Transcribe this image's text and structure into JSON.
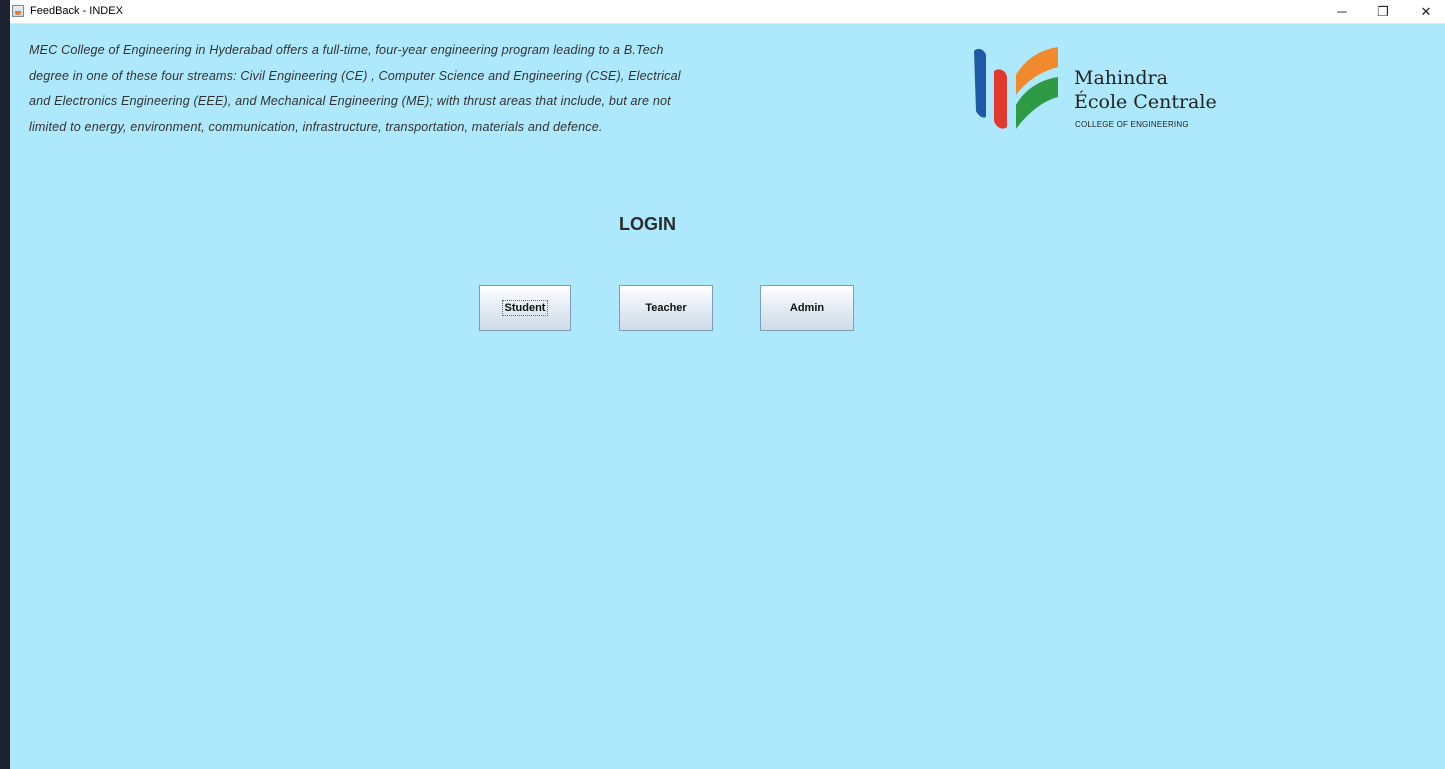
{
  "window": {
    "title": "FeedBack - INDEX",
    "controls": {
      "minimize": "─",
      "maximize": "❐",
      "close": "✕"
    }
  },
  "description": {
    "lines": [
      "MEC College of Engineering in Hyderabad offers a full-time, four-year engineering program leading to a B.Tech",
      "degree in one of these four streams: Civil Engineering (CE) , Computer Science and Engineering (CSE), Electrical",
      "and Electronics Engineering (EEE), and Mechanical Engineering (ME); with thrust areas that include, but are not",
      "limited to energy, environment, communication, infrastructure, transportation, materials and defence."
    ]
  },
  "logo": {
    "name_line1": "Mahindra",
    "name_line2": "École Centrale",
    "subtitle": "COLLEGE OF ENGINEERING",
    "colors": {
      "blue": "#1f5aa6",
      "red": "#e03a2f",
      "orange": "#f08a2c",
      "green": "#2f9a45"
    }
  },
  "login": {
    "title": "LOGIN",
    "buttons": {
      "student": "Student",
      "teacher": "Teacher",
      "admin": "Admin"
    }
  },
  "colors": {
    "background": "#aee8fc"
  }
}
